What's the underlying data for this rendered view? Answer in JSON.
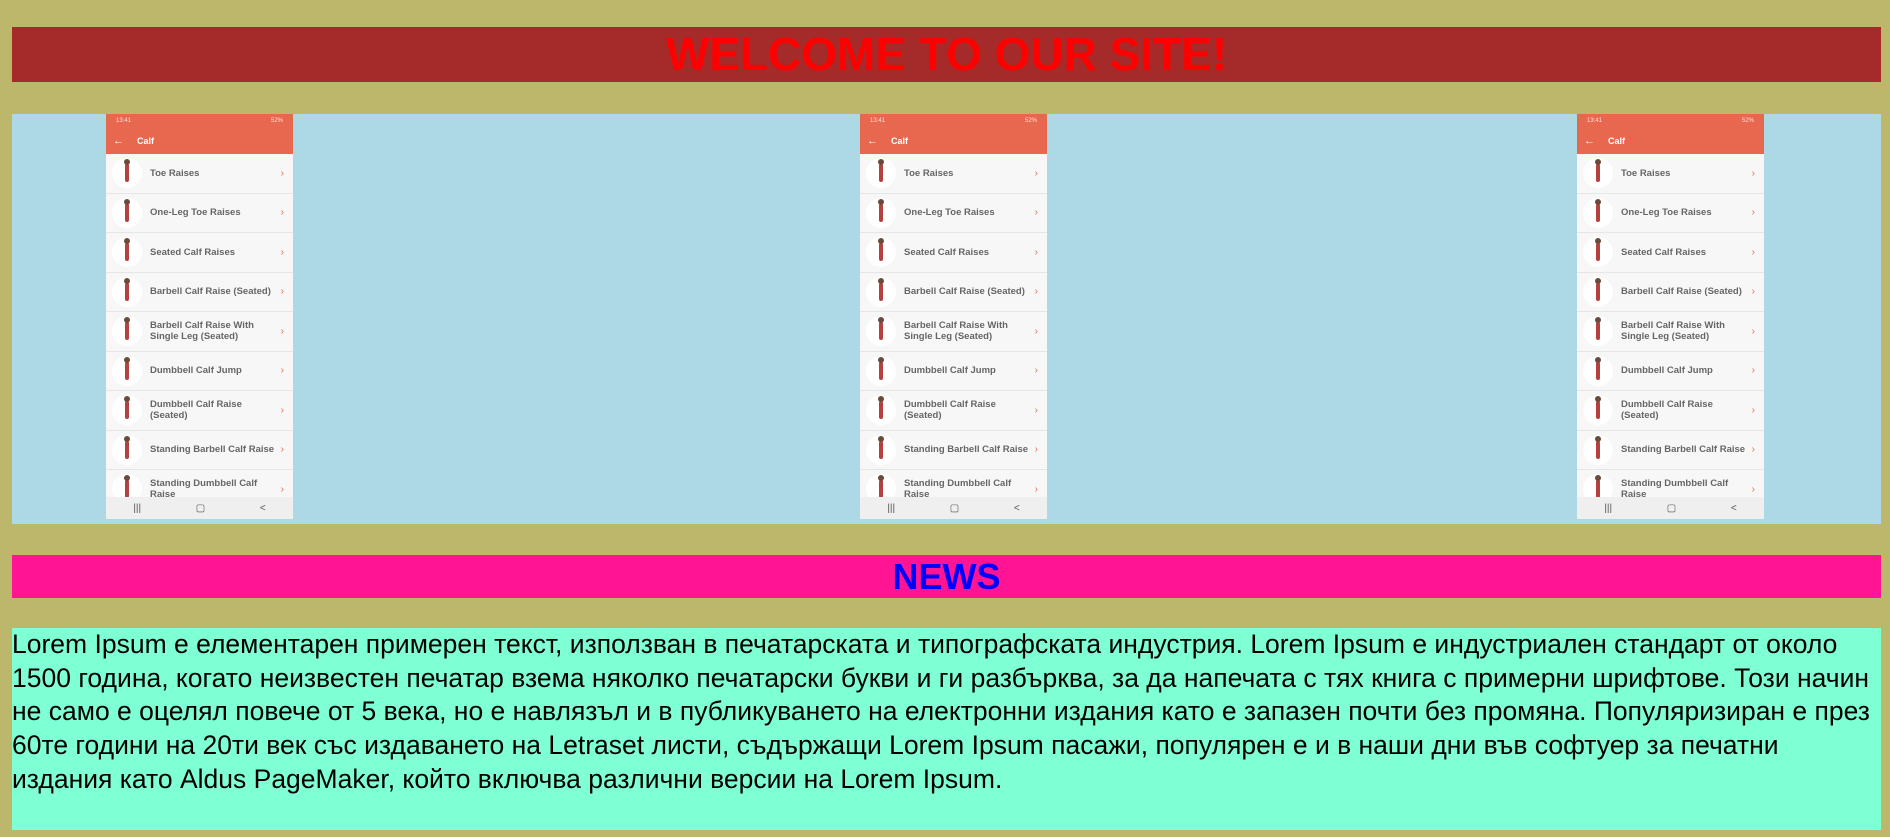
{
  "header": {
    "title": "WELCOME TO OUR SITE!"
  },
  "gallery": {
    "screens": [
      {
        "status": {
          "time": "13:41",
          "indicators": "52%"
        },
        "title": "Calf",
        "items": [
          "Toe Raises",
          "One-Leg Toe Raises",
          "Seated Calf Raises",
          "Barbell Calf Raise (Seated)",
          "Barbell Calf Raise With Single Leg (Seated)",
          "Dumbbell Calf Jump",
          "Dumbbell Calf Raise (Seated)",
          "Standing Barbell Calf Raise",
          "Standing Dumbbell Calf Raise"
        ],
        "nav": {
          "recent": "|||",
          "home": "▢",
          "back": "<"
        }
      },
      {
        "status": {
          "time": "13:41",
          "indicators": "52%"
        },
        "title": "Calf",
        "items": [
          "Toe Raises",
          "One-Leg Toe Raises",
          "Seated Calf Raises",
          "Barbell Calf Raise (Seated)",
          "Barbell Calf Raise With Single Leg (Seated)",
          "Dumbbell Calf Jump",
          "Dumbbell Calf Raise (Seated)",
          "Standing Barbell Calf Raise",
          "Standing Dumbbell Calf Raise"
        ],
        "nav": {
          "recent": "|||",
          "home": "▢",
          "back": "<"
        }
      },
      {
        "status": {
          "time": "13:41",
          "indicators": "52%"
        },
        "title": "Calf",
        "items": [
          "Toe Raises",
          "One-Leg Toe Raises",
          "Seated Calf Raises",
          "Barbell Calf Raise (Seated)",
          "Barbell Calf Raise With Single Leg (Seated)",
          "Dumbbell Calf Jump",
          "Dumbbell Calf Raise (Seated)",
          "Standing Barbell Calf Raise",
          "Standing Dumbbell Calf Raise"
        ],
        "nav": {
          "recent": "|||",
          "home": "▢",
          "back": "<"
        }
      }
    ]
  },
  "news": {
    "title": "NEWS"
  },
  "article": {
    "text": "Lorem Ipsum е елементарен примерен текст, използван в печатарската и типографската индустрия. Lorem Ipsum е индустриален стандарт от около 1500 година, когато неизвестен печатар взема няколко печатарски букви и ги разбърква, за да напечата с тях книга с примерни шрифтове. Този начин не само е оцелял повече от 5 века, но е навлязъл и в публикуването на електронни издания като е запазен почти без промяна. Популяризиран е през 60те години на 20ти век със издаването на Letraset листи, съдържащи Lorem Ipsum пасажи, популярен е и в наши дни във софтуер за печатни издания като Aldus PageMaker, който включва различни версии на Lorem Ipsum."
  },
  "colors": {
    "page_bg": "#bdb76b",
    "welcome_bg": "#a52a2a",
    "welcome_text": "#ff0000",
    "gallery_bg": "#add8e6",
    "news_bg": "#ff1493",
    "news_text": "#0000ff",
    "article_bg": "#7fffd4",
    "app_accent": "#e8684f"
  }
}
